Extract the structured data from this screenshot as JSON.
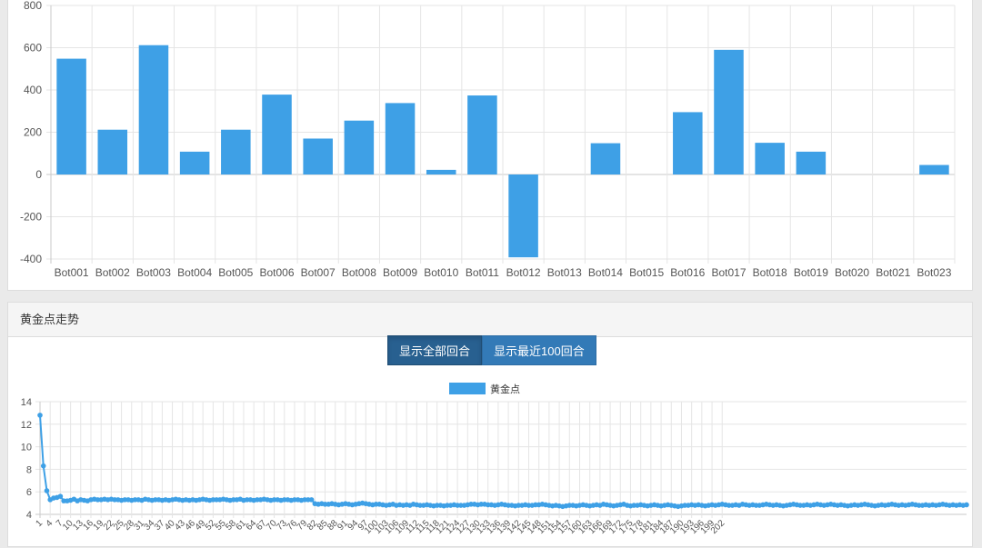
{
  "colors": {
    "series": "#3ea0e6",
    "grid": "#e5e5e5",
    "axis": "#c8c8c8",
    "text": "#555555"
  },
  "score_chart": {
    "chart_data": {
      "type": "bar",
      "categories": [
        "Bot001",
        "Bot002",
        "Bot003",
        "Bot004",
        "Bot005",
        "Bot006",
        "Bot007",
        "Bot008",
        "Bot009",
        "Bot010",
        "Bot011",
        "Bot012",
        "Bot013",
        "Bot014",
        "Bot015",
        "Bot016",
        "Bot017",
        "Bot018",
        "Bot019",
        "Bot020",
        "Bot021",
        "Bot023"
      ],
      "values": [
        548,
        212,
        612,
        108,
        212,
        378,
        170,
        255,
        338,
        22,
        374,
        -392,
        0,
        148,
        0,
        295,
        590,
        150,
        108,
        0,
        0,
        45
      ],
      "ylim": [
        -400,
        800
      ],
      "yticks": [
        800,
        600,
        400,
        200,
        0,
        -200,
        -400
      ],
      "grid": true
    }
  },
  "trend_panel": {
    "title": "黄金点走势",
    "buttons": [
      "显示全部回合",
      "显示最近100回合"
    ],
    "chart_data": {
      "type": "line",
      "series": [
        {
          "name": "黄金点",
          "values": [
            12.8,
            8.3,
            6.1,
            5.3,
            5.45,
            5.5,
            5.6,
            5.2,
            5.2,
            5.25,
            5.35,
            5.2,
            5.3,
            5.25,
            5.2,
            5.3,
            5.35,
            5.3,
            5.3,
            5.35,
            5.3,
            5.35,
            5.3,
            5.3,
            5.25,
            5.3,
            5.3,
            5.25,
            5.3,
            5.3,
            5.25,
            5.35,
            5.3,
            5.25,
            5.3,
            5.3,
            5.25,
            5.3,
            5.25,
            5.3,
            5.35,
            5.3,
            5.25,
            5.3,
            5.25,
            5.3,
            5.25,
            5.3,
            5.35,
            5.3,
            5.25,
            5.3,
            5.3,
            5.3,
            5.35,
            5.3,
            5.25,
            5.3,
            5.3,
            5.35,
            5.25,
            5.3,
            5.3,
            5.25,
            5.3,
            5.3,
            5.35,
            5.3,
            5.25,
            5.3,
            5.3,
            5.25,
            5.3,
            5.3,
            5.25,
            5.3,
            5.3,
            5.25,
            5.3,
            5.3,
            5.3,
            4.95,
            4.9,
            4.95,
            4.9,
            4.9,
            4.95,
            4.9,
            4.85,
            4.9,
            4.95,
            4.9,
            4.85,
            4.9,
            4.95,
            5.0,
            4.95,
            4.9,
            4.85,
            4.9,
            4.9,
            4.85,
            4.8,
            4.85,
            4.9,
            4.8,
            4.85,
            4.8,
            4.85,
            4.8,
            4.9,
            4.85,
            4.8,
            4.8,
            4.85,
            4.8,
            4.75,
            4.8,
            4.8,
            4.75,
            4.8,
            4.8,
            4.85,
            4.8,
            4.8,
            4.8,
            4.85,
            4.9,
            4.9,
            4.85,
            4.9,
            4.9,
            4.85,
            4.85,
            4.8,
            4.85,
            4.9,
            4.85,
            4.8,
            4.8,
            4.75,
            4.8,
            4.8,
            4.85,
            4.8,
            4.8,
            4.85,
            4.85,
            4.9,
            4.85,
            4.8,
            4.75,
            4.8,
            4.75,
            4.7,
            4.75,
            4.8,
            4.8,
            4.75,
            4.8,
            4.85,
            4.8,
            4.75,
            4.8,
            4.85,
            4.8,
            4.9,
            4.85,
            4.8,
            4.75,
            4.8,
            4.85,
            4.9,
            4.8,
            4.75,
            4.8,
            4.8,
            4.85,
            4.8,
            4.75,
            4.8,
            4.85,
            4.8,
            4.75,
            4.8,
            4.85,
            4.8,
            4.75,
            4.7,
            4.75,
            4.8,
            4.8,
            4.85,
            4.8,
            4.85,
            4.8,
            4.75,
            4.8,
            4.85,
            4.8,
            4.85,
            4.9,
            4.85,
            4.8,
            4.8,
            4.85,
            4.8,
            4.9,
            4.85,
            4.8,
            4.85,
            4.8,
            4.8,
            4.85,
            4.9,
            4.85,
            4.8,
            4.85,
            4.8,
            4.75,
            4.8,
            4.85,
            4.9,
            4.85,
            4.8,
            4.8,
            4.85,
            4.8,
            4.85,
            4.9,
            4.85,
            4.8,
            4.85,
            4.9,
            4.85,
            4.8,
            4.85,
            4.8,
            4.75,
            4.8,
            4.85,
            4.8,
            4.85,
            4.9,
            4.85,
            4.8,
            4.75,
            4.8,
            4.85,
            4.8,
            4.85,
            4.9,
            4.85,
            4.8,
            4.85,
            4.8,
            4.85,
            4.9,
            4.85,
            4.8,
            4.8,
            4.85,
            4.8,
            4.85,
            4.8,
            4.85,
            4.9,
            4.85,
            4.8,
            4.85,
            4.8,
            4.85,
            4.8,
            4.85
          ]
        }
      ],
      "x_start": 1,
      "x_end": 202,
      "x_tick_step": 3,
      "ylim": [
        4,
        14
      ],
      "yticks": [
        14,
        12,
        10,
        8,
        6,
        4
      ],
      "legend": "top-center",
      "grid": true
    }
  }
}
